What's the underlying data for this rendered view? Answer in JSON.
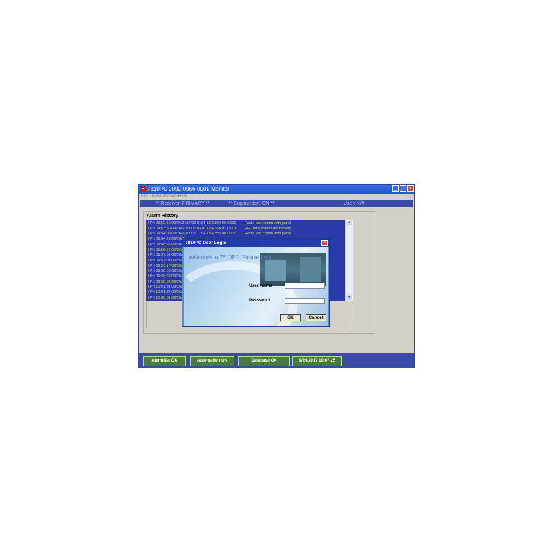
{
  "window": {
    "app_icon": "H",
    "title": "7810PC  0092-0066-0001 Monitor",
    "min_icon": "minimize-icon",
    "max_icon": "maximize-icon",
    "close_icon": "close-icon"
  },
  "menu": [
    "File",
    "Tools",
    "Language",
    "Help"
  ],
  "status": {
    "receiver": "** Receiver: PRIMARY **",
    "supervision": "** Supervision: ON **",
    "user": "User: N/A"
  },
  "alarm_history": {
    "label": "Alarm History",
    "rows": [
      {
        "text": "I Pri 09:52:10 09/26/2017 00 0151 18 E360 00 C000",
        "msg": "Radio lost comm with panel"
      },
      {
        "text": "I Pri 09:53:50 09/26/2017 00 0376 18 R384 01 C001",
        "msg": "RF Transmitter Low Battery"
      },
      {
        "text": "I Pri 09:54:09 09/26/2017 00 1704 18 E355 00 C000",
        "msg": "Radio lost comm with panel"
      },
      {
        "text": "I Pri 09:54:23 09/26/2",
        "msg": ""
      },
      {
        "text": "I Pri 09:56:55 09/26/2",
        "msg": ""
      },
      {
        "text": "I Pri 09:56:56 09/26/2",
        "msg": ""
      },
      {
        "text": "I Pri 09:57:01 09/26/2",
        "msg": ""
      },
      {
        "text": "I Pri 09:57:03 09/26/2",
        "msg": ""
      },
      {
        "text": "I Pri 09:57:17 09/26/2",
        "msg": ""
      },
      {
        "text": "I Pri 09:58:05 09/26/2",
        "msg": ""
      },
      {
        "text": "I Pri 09:58:52 09/26/2",
        "msg": ""
      },
      {
        "text": "I Pri 09:58:52 09/26/2",
        "msg": ""
      },
      {
        "text": "I Pri 10:01:31 09/26/2",
        "msg": ""
      },
      {
        "text": "I Pri 10:01:34 09/26/2",
        "msg": ""
      },
      {
        "text": "I Pri 10:03:51 09/26/2",
        "msg": ""
      }
    ]
  },
  "bottom": {
    "alarmnet": "AlarmNet OK",
    "automation": "Automation OK",
    "database": "Database OK",
    "clock": "9/26/2017 10:07:25"
  },
  "login": {
    "title": "7810PC User Login",
    "close_icon": "close-icon",
    "welcome": "Welcome to 7810PC.  Please Login.",
    "username_label": "User Name",
    "password_label": "Password",
    "username_value": "",
    "password_value": "",
    "ok": "OK",
    "cancel": "Cancel"
  },
  "colors": {
    "title_bar": "#2356c8",
    "status_bar": "#3b4aa5",
    "alarm_text": "#d2dc64",
    "status_button": "#4a7a44"
  }
}
